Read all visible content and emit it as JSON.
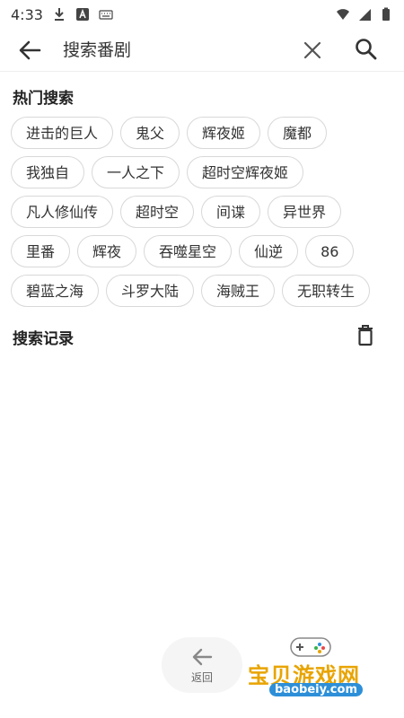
{
  "status_bar": {
    "time": "4:33",
    "icons": [
      "download-icon",
      "a-badge-icon",
      "keyboard-icon",
      "wifi-icon",
      "signal-icon",
      "battery-icon"
    ]
  },
  "search": {
    "placeholder": "搜索番剧",
    "back_icon": "arrow-left-icon",
    "clear_icon": "close-icon",
    "search_icon": "search-icon"
  },
  "hot_search": {
    "title": "热门搜索",
    "rows": [
      [
        "进击的巨人",
        "鬼父",
        "辉夜姬",
        "魔都"
      ],
      [
        "我独自",
        "一人之下",
        "超时空辉夜姬"
      ],
      [
        "凡人修仙传",
        "超时空",
        "间谍",
        "异世界"
      ],
      [
        "里番",
        "辉夜",
        "吞噬星空",
        "仙逆",
        "86"
      ],
      [
        "碧蓝之海",
        "斗罗大陆",
        "海贼王",
        "无职转生"
      ]
    ]
  },
  "history": {
    "title": "搜索记录",
    "clear_icon": "trash-icon"
  },
  "bottom": {
    "return_label": "返回",
    "return_icon": "arrow-left-icon"
  },
  "watermark": {
    "title": "宝贝游戏网",
    "domain": "baobeiy.com"
  },
  "colors": {
    "text": "#222222",
    "tag_border": "#d8d8d8",
    "watermark_gold": "#e8a400",
    "watermark_blue": "#2d8fd8"
  }
}
